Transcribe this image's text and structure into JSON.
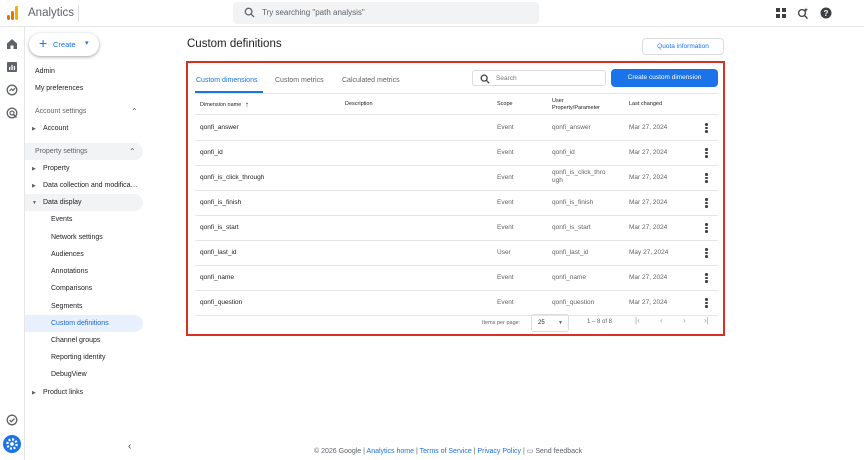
{
  "app": {
    "title": "Analytics",
    "search_placeholder": "Try searching \"path analysis\""
  },
  "colors": {
    "accent": "#1a73e8",
    "highlight_border": "#d93025",
    "logo": [
      "#f9ab00",
      "#e37400",
      "#e37400"
    ]
  },
  "top_icons": [
    "apps-grid-icon",
    "search-insights-icon",
    "help-icon"
  ],
  "rail_icons": [
    "home-icon",
    "reports-icon",
    "explore-icon",
    "advertising-icon",
    "admin-check-icon",
    "settings-gear-icon"
  ],
  "nav": {
    "create_label": "Create",
    "admin": "Admin",
    "my_preferences": "My preferences",
    "account_settings": "Account settings",
    "account": "Account",
    "property_settings": "Property settings",
    "property": "Property",
    "data_collection": "Data collection and modifica…",
    "data_display": "Data display",
    "sub_items": [
      "Events",
      "Network settings",
      "Audiences",
      "Annotations",
      "Comparisons",
      "Segments",
      "Custom definitions",
      "Channel groups",
      "Reporting identity",
      "DebugView"
    ],
    "product_links": "Product links"
  },
  "page": {
    "title": "Custom definitions",
    "quota_button": "Quota information"
  },
  "tabs": [
    "Custom dimensions",
    "Custom metrics",
    "Calculated metrics"
  ],
  "search": {
    "placeholder": "Search"
  },
  "create_dimension_button": "Create custom dimension",
  "table": {
    "headers": {
      "name": "Dimension name",
      "description": "Description",
      "scope": "Scope",
      "param_line1": "User",
      "param_line2": "Property/Parameter",
      "last_changed": "Last changed"
    },
    "rows": [
      {
        "name": "qonfi_answer",
        "description": "",
        "scope": "Event",
        "param": "qonfi_answer",
        "param2": "",
        "changed": "Mar 27, 2024"
      },
      {
        "name": "qonfi_id",
        "description": "",
        "scope": "Event",
        "param": "qonfi_id",
        "param2": "",
        "changed": "Mar 27, 2024"
      },
      {
        "name": "qonfi_is_click_through",
        "description": "",
        "scope": "Event",
        "param": "qonfi_is_click_thro",
        "param2": "ugh",
        "changed": "Mar 27, 2024"
      },
      {
        "name": "qonfi_is_finish",
        "description": "",
        "scope": "Event",
        "param": "qonfi_is_finish",
        "param2": "",
        "changed": "Mar 27, 2024"
      },
      {
        "name": "qonfi_is_start",
        "description": "",
        "scope": "Event",
        "param": "qonfi_is_start",
        "param2": "",
        "changed": "Mar 27, 2024"
      },
      {
        "name": "qonfi_last_id",
        "description": "",
        "scope": "User",
        "param": "qonfi_last_id",
        "param2": "",
        "changed": "May 27, 2024"
      },
      {
        "name": "qonfi_name",
        "description": "",
        "scope": "Event",
        "param": "qonfi_name",
        "param2": "",
        "changed": "Mar 27, 2024"
      },
      {
        "name": "qonfi_question",
        "description": "",
        "scope": "Event",
        "param": "qonfi_question",
        "param2": "",
        "changed": "Mar 27, 2024"
      }
    ]
  },
  "pagination": {
    "label": "Items per page:",
    "per_page": "25",
    "range": "1 – 8 of 8"
  },
  "footer": {
    "copyright": "© 2026 Google |",
    "analytics_home": "Analytics home",
    "terms": "Terms of Service",
    "privacy": "Privacy Policy",
    "feedback": "Send feedback"
  }
}
